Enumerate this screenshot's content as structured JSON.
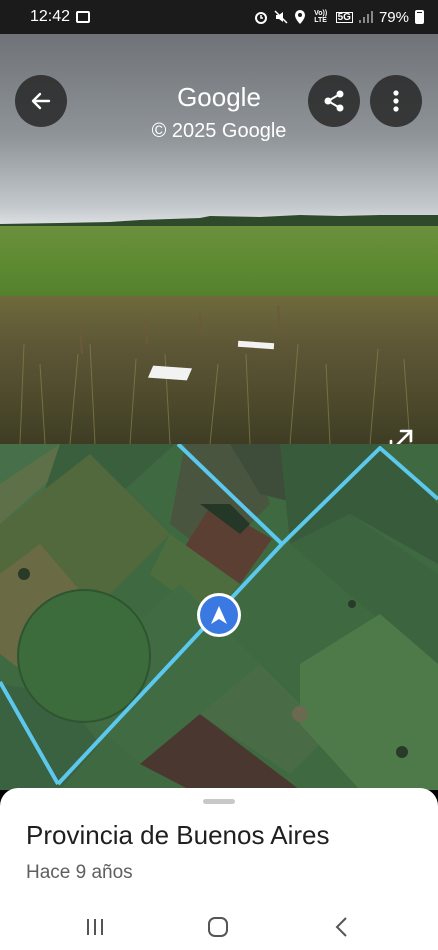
{
  "status_bar": {
    "time": "12:42",
    "network_label": "5G",
    "volte_label": "Vo)) LTE",
    "battery_percent": "79%",
    "icons": [
      "image-icon",
      "alarm-icon",
      "mute-icon",
      "location-icon",
      "signal-icon",
      "battery-icon"
    ]
  },
  "street_view": {
    "title": "Google",
    "subtitle": "© 2025 Google",
    "buttons": [
      "back",
      "share",
      "more-options",
      "expand"
    ]
  },
  "map": {
    "marker": "navigation-arrow",
    "route_color": "#5cc8ee"
  },
  "place": {
    "title": "Provincia de Buenos Aires",
    "subtitle": "Hace 9 años"
  },
  "nav_bar": {
    "items": [
      "recents",
      "home",
      "back"
    ]
  }
}
